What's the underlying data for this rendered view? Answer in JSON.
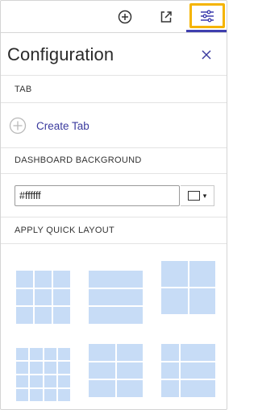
{
  "toolbar": {
    "buttons": [
      {
        "name": "add-circle-icon"
      },
      {
        "name": "share-icon"
      },
      {
        "name": "sliders-icon",
        "active": true
      }
    ],
    "accent_color": "#3f3fae",
    "highlight_color": "#f5b400"
  },
  "header": {
    "title": "Configuration",
    "close_icon": "close-icon"
  },
  "tab_section": {
    "label": "TAB",
    "create_tab_label": "Create Tab"
  },
  "background_section": {
    "label": "DASHBOARD BACKGROUND",
    "value": "#ffffff",
    "swatch_color": "#ffffff",
    "caret": "▾"
  },
  "layout_section": {
    "label": "APPLY QUICK LAYOUT",
    "cell_color": "#c7dcf6",
    "layouts": [
      {
        "name": "layout-3x3"
      },
      {
        "name": "layout-3-rows"
      },
      {
        "name": "layout-2x2"
      },
      {
        "name": "layout-4x4"
      },
      {
        "name": "layout-2-wide-columns"
      },
      {
        "name": "layout-wide-and-narrow-columns"
      }
    ]
  }
}
